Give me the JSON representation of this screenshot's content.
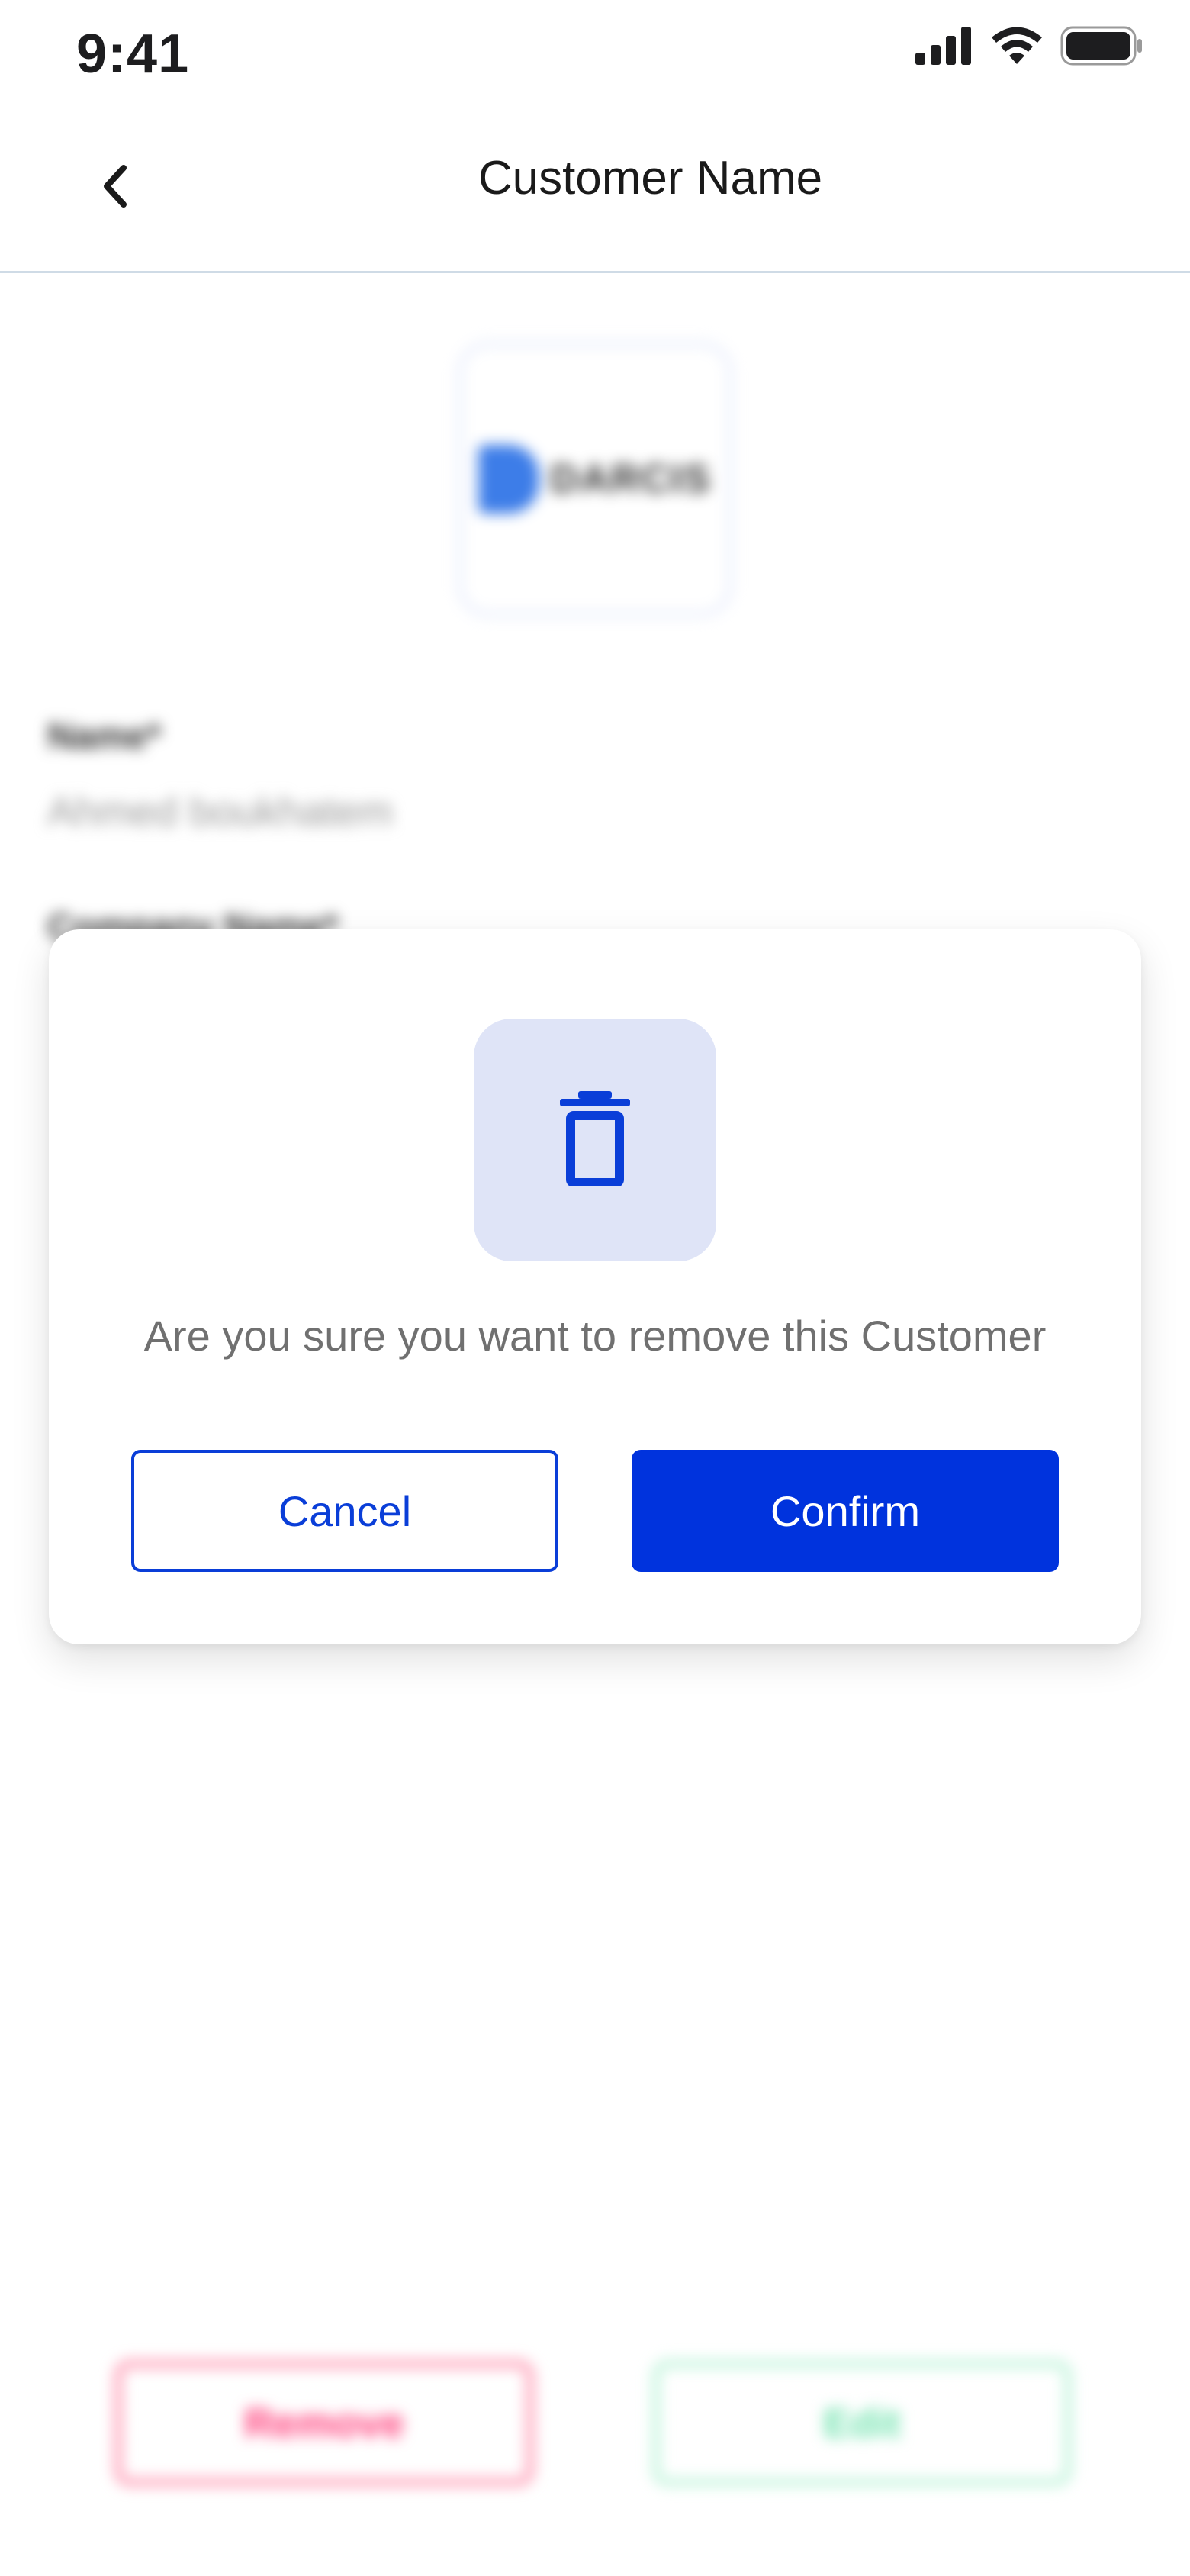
{
  "status_bar": {
    "time": "9:41",
    "icons": [
      "cellular-signal-icon",
      "wifi-icon",
      "battery-icon"
    ]
  },
  "nav": {
    "title": "Customer Name",
    "back_icon": "chevron-left-icon"
  },
  "background": {
    "logo_text": "DARCIS",
    "name_label": "Name*",
    "name_value": "Ahmed boukhatem",
    "company_label": "Company Name*",
    "remove_label": "Remove",
    "edit_label": "Edit"
  },
  "modal": {
    "icon": "trash-icon",
    "message": "Are you sure you want to remove this Customer",
    "cancel_label": "Cancel",
    "confirm_label": "Confirm"
  },
  "colors": {
    "primary": "#0033dd",
    "icon_bg": "#dfe4f7",
    "remove": "#ff3d7a",
    "edit": "#6fe2ad"
  }
}
